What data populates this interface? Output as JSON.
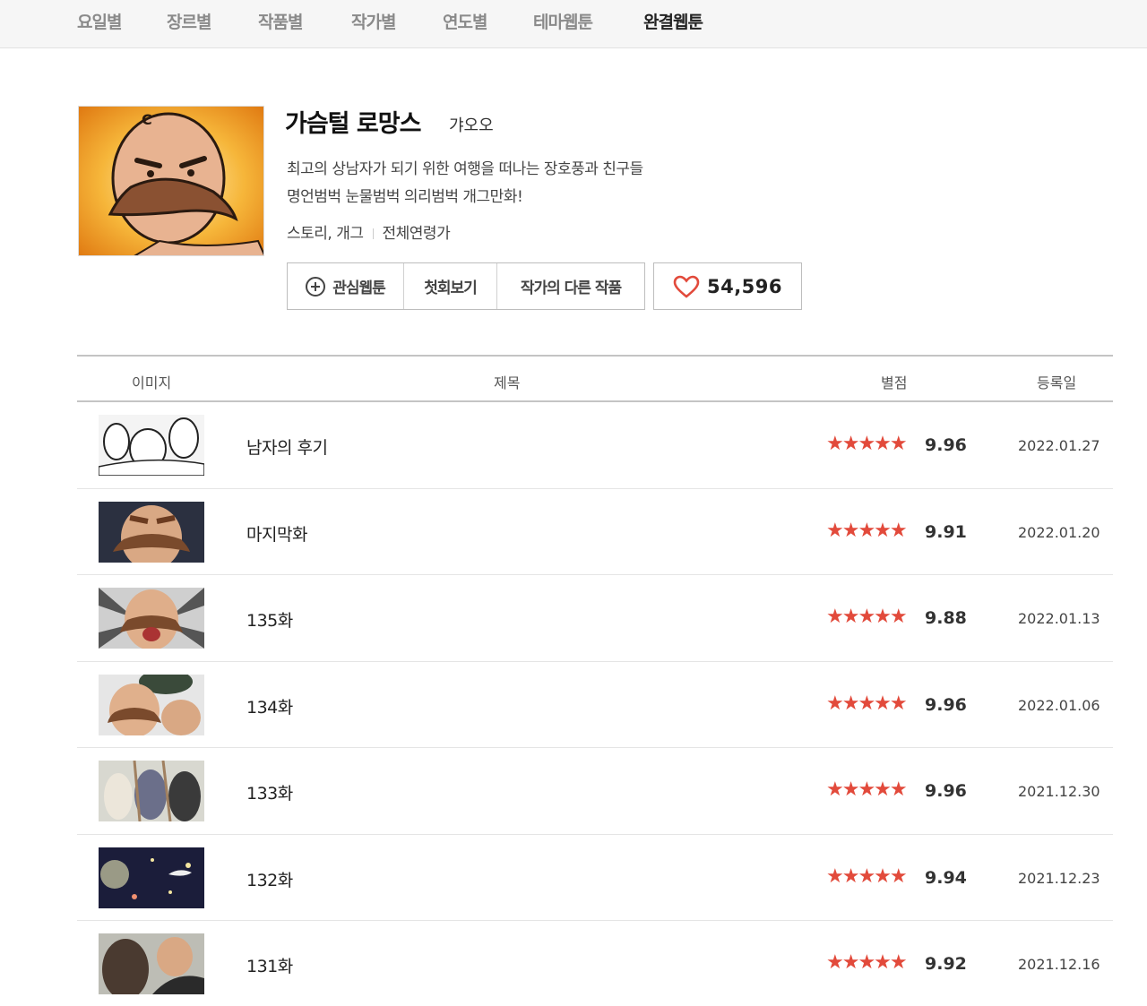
{
  "nav": {
    "items": [
      "요일별",
      "장르별",
      "작품별",
      "작가별",
      "연도별",
      "테마웹툰",
      "완결웹툰"
    ],
    "active_index": 6
  },
  "webtoon": {
    "title": "가슴털 로망스",
    "author": "갸오오",
    "description": [
      "최고의 상남자가 되기 위한 여행을 떠나는 장호풍과 친구들",
      "명언범벅 눈물범벅 의리범벅 개그만화!"
    ],
    "genre": "스토리, 개그",
    "age_rating": "전체연령가"
  },
  "buttons": {
    "favorite": "관심웹툰",
    "first_episode": "첫회보기",
    "other_works": "작가의 다른 작품",
    "like_count": "54,596"
  },
  "table": {
    "headers": {
      "image": "이미지",
      "title": "제목",
      "rating": "별점",
      "date": "등록일"
    },
    "rows": [
      {
        "title": "남자의 후기",
        "stars": "★★★★★",
        "score": "9.96",
        "date": "2022.01.27"
      },
      {
        "title": "마지막화",
        "stars": "★★★★★",
        "score": "9.91",
        "date": "2022.01.20"
      },
      {
        "title": "135화",
        "stars": "★★★★★",
        "score": "9.88",
        "date": "2022.01.13"
      },
      {
        "title": "134화",
        "stars": "★★★★★",
        "score": "9.96",
        "date": "2022.01.06"
      },
      {
        "title": "133화",
        "stars": "★★★★★",
        "score": "9.96",
        "date": "2021.12.30"
      },
      {
        "title": "132화",
        "stars": "★★★★★",
        "score": "9.94",
        "date": "2021.12.23"
      },
      {
        "title": "131화",
        "stars": "★★★★★",
        "score": "9.92",
        "date": "2021.12.16"
      }
    ]
  },
  "colors": {
    "star": "#e24a3b",
    "heart": "#e24a3b",
    "nav_active": "#222222",
    "nav_inactive": "#8a8a8a"
  }
}
